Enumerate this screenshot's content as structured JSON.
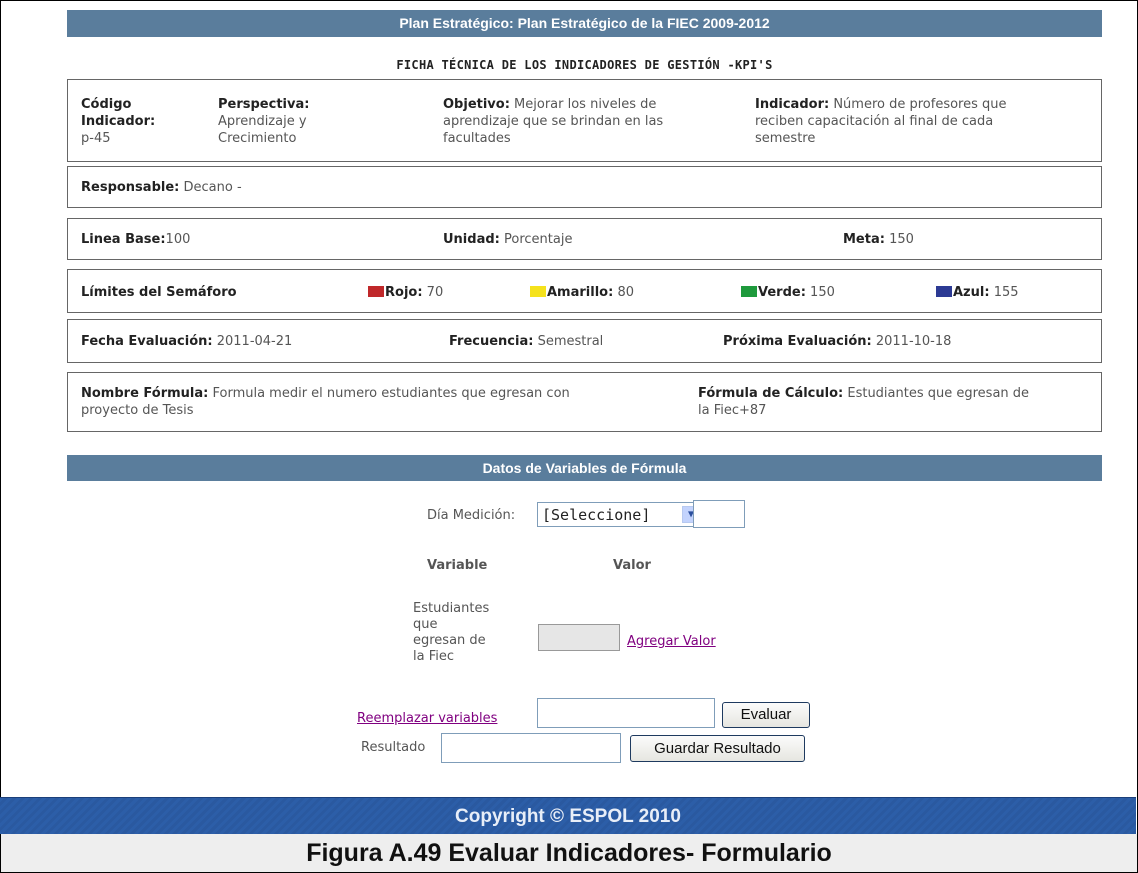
{
  "header": {
    "title": "Plan Estratégico: Plan Estratégico de la FIEC 2009-2012"
  },
  "ficha": {
    "title": "FICHA TÉCNICA DE LOS INDICADORES DE GESTIÓN -KPI'S"
  },
  "row1": {
    "codigo_label_1": "Código",
    "codigo_label_2": "Indicador:",
    "codigo_value": "p-45",
    "perspectiva_label": "Perspectiva:",
    "perspectiva_value_1": "Aprendizaje y",
    "perspectiva_value_2": "Crecimiento",
    "objetivo_label": "Objetivo:",
    "objetivo_value_1": "Mejorar los niveles de",
    "objetivo_value_2": "aprendizaje que se brindan en las",
    "objetivo_value_3": "facultades",
    "indicador_label": "Indicador:",
    "indicador_value_1": "Número de profesores que",
    "indicador_value_2": "reciben capacitación al final de cada",
    "indicador_value_3": "semestre"
  },
  "row2": {
    "responsable_label": "Responsable:",
    "responsable_value": "Decano -"
  },
  "row3": {
    "linea_label": "Linea Base:",
    "linea_value": "100",
    "unidad_label": "Unidad:",
    "unidad_value": "Porcentaje",
    "meta_label": "Meta:",
    "meta_value": "150"
  },
  "semaforo": {
    "label": "Límites del Semáforo",
    "rojo_label": "Rojo:",
    "rojo_value": "70",
    "rojo_color": "#c0282a",
    "amarillo_label": "Amarillo:",
    "amarillo_value": "80",
    "amarillo_color": "#f5e21c",
    "verde_label": "Verde:",
    "verde_value": "150",
    "verde_color": "#1e9a3c",
    "azul_label": "Azul:",
    "azul_value": "155",
    "azul_color": "#2c3a94"
  },
  "row5": {
    "fecha_label": "Fecha Evaluación:",
    "fecha_value": "2011-04-21",
    "frecuencia_label": "Frecuencia:",
    "frecuencia_value": "Semestral",
    "proxima_label": "Próxima Evaluación:",
    "proxima_value": "2011-10-18"
  },
  "row6": {
    "nombre_label": "Nombre Fórmula:",
    "nombre_value_1": "Formula medir el numero estudiantes que egresan con",
    "nombre_value_2": "proyecto de Tesis",
    "calculo_label": "Fórmula de Cálculo:",
    "calculo_value_1": "Estudiantes que egresan de",
    "calculo_value_2": "la Fiec+87"
  },
  "datos": {
    "title": "Datos de Variables de Fórmula"
  },
  "form": {
    "dia_label": "Día Medición:",
    "dia_select": "[Seleccione]",
    "variable_header": "Variable",
    "valor_header": "Valor",
    "variable_name_1": "Estudiantes",
    "variable_name_2": "que",
    "variable_name_3": "egresan de",
    "variable_name_4": "la Fiec",
    "agregar_link": "Agregar Valor",
    "reemplazar_link": "Reemplazar variables",
    "evaluar_button": "Evaluar",
    "resultado_label": "Resultado",
    "guardar_button": "Guardar Resultado"
  },
  "footer": {
    "copyright": "Copyright © ESPOL 2010"
  },
  "caption": {
    "text": "Figura A.49 Evaluar Indicadores- Formulario"
  }
}
